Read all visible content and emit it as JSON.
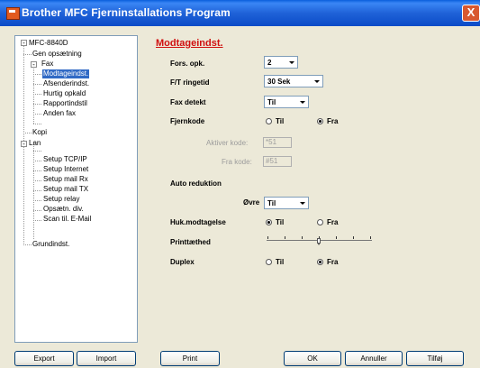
{
  "window": {
    "title": "Brother MFC Fjerninstallations Program",
    "close_label": "X"
  },
  "tree": {
    "root": "MFC-8840D",
    "items": [
      "Gen opsætning",
      "Fax",
      "Modtageindst.",
      "Afsenderindst.",
      "Hurtig opkald",
      "Rapportindstil",
      "Anden fax",
      "Kopi",
      "Lan",
      "Setup TCP/IP",
      "Setup Internet",
      "Setup mail Rx",
      "Setup mail TX",
      "Setup relay",
      "Opsætn. div.",
      "Scan til. E-Mail",
      "Grundindst."
    ],
    "expanders": [
      "-",
      "-",
      "-",
      "-"
    ]
  },
  "panel": {
    "title": "Modtageindst.",
    "rings_label": "Fors. opk.",
    "rings_value": "2",
    "ft_label": "F/T ringetid",
    "ft_value": "30 Sek",
    "fax_detect_label": "Fax detekt",
    "fax_detect_value": "Til",
    "remote_label": "Fjernkode",
    "remote_on": "Til",
    "remote_off": "Fra",
    "remote_selected": "Fra",
    "activate_label": "Aktiver kode:",
    "activate_value": "*51",
    "deactivate_label": "Fra kode:",
    "deactivate_value": "#51",
    "auto_reduction_label": "Auto reduktion",
    "upper_label": "Øvre",
    "upper_value": "Til",
    "memory_label": "Huk.modtagelse",
    "memory_on": "Til",
    "memory_off": "Fra",
    "memory_selected": "Til",
    "density_label": "Printtæthed",
    "density_level": 0.5,
    "duplex_label": "Duplex",
    "duplex_on": "Til",
    "duplex_off": "Fra",
    "duplex_selected": "Fra"
  },
  "buttons": {
    "export": "Export",
    "import": "Import",
    "print": "Print",
    "ok": "OK",
    "cancel": "Annuller",
    "apply": "Tilføj"
  }
}
